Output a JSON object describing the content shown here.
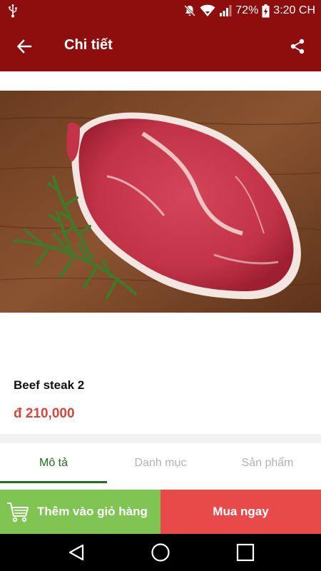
{
  "status_bar": {
    "battery": "72%",
    "time": "3:20 CH"
  },
  "app_bar": {
    "title": "Chi tiết"
  },
  "product": {
    "name": "Beef steak 2",
    "price": "đ 210,000"
  },
  "tabs": [
    {
      "label": "Mô tả",
      "active": true
    },
    {
      "label": "Danh mục",
      "active": false
    },
    {
      "label": "Sản phẩm",
      "active": false
    }
  ],
  "actions": {
    "add_to_cart": "Thêm vào giỏ hàng",
    "buy_now": "Mua ngay"
  },
  "colors": {
    "primary": "#8e0e0e",
    "add_to_cart": "#80c554",
    "buy_now": "#e84a4a",
    "price": "#d9463c",
    "active_tab": "#1f6f1f"
  },
  "icons": {
    "back": "arrow-left-icon",
    "share": "share-icon",
    "cart": "cart-icon",
    "nav": [
      "back-triangle-icon",
      "home-circle-icon",
      "recents-square-icon"
    ]
  }
}
